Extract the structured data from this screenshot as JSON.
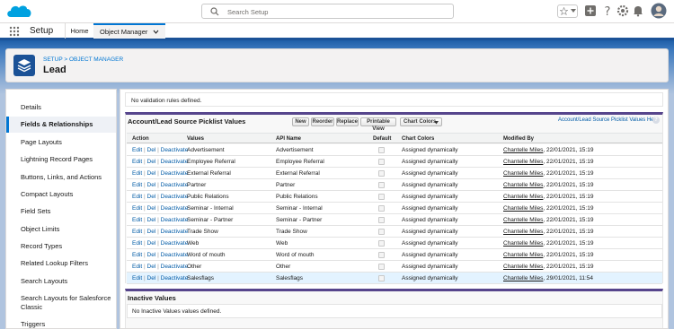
{
  "header": {
    "search_placeholder": "Search Setup"
  },
  "nav": {
    "app_name": "Setup",
    "tabs": [
      {
        "label": "Home"
      },
      {
        "label": "Object Manager"
      }
    ]
  },
  "page_header": {
    "breadcrumb": "SETUP > OBJECT MANAGER",
    "title": "Lead"
  },
  "sidebar": {
    "items": [
      {
        "label": "Details"
      },
      {
        "label": "Fields & Relationships",
        "active": true
      },
      {
        "label": "Page Layouts"
      },
      {
        "label": "Lightning Record Pages"
      },
      {
        "label": "Buttons, Links, and Actions"
      },
      {
        "label": "Compact Layouts"
      },
      {
        "label": "Field Sets"
      },
      {
        "label": "Object Limits"
      },
      {
        "label": "Record Types"
      },
      {
        "label": "Related Lookup Filters"
      },
      {
        "label": "Search Layouts"
      },
      {
        "label": "Search Layouts for Salesforce"
      },
      {
        "label": "Classic"
      },
      {
        "label": "Triggers"
      }
    ]
  },
  "validation": {
    "text": "No validation rules defined."
  },
  "picklist": {
    "title": "Account/Lead Source Picklist Values",
    "buttons": {
      "new": "New",
      "reorder": "Reorder",
      "replace": "Replace",
      "printable_view": "Printable View",
      "chart_colors": "Chart Colors"
    },
    "help_link": "Account/Lead Source Picklist Values Help",
    "help_icon": "?",
    "columns": {
      "action": "Action",
      "values": "Values",
      "api_name": "API Name",
      "default": "Default",
      "chart_colors": "Chart Colors",
      "modified_by": "Modified By"
    },
    "action_links": {
      "edit": "Edit",
      "del": "Del",
      "deactivate": "Deactivate",
      "sep": "|"
    },
    "rows": [
      {
        "value": "Advertisement",
        "api": "Advertisement",
        "color": "Assigned dynamically",
        "user": "Chantelle Miles",
        "date": ", 22/01/2021, 15:19"
      },
      {
        "value": "Employee Referral",
        "api": "Employee Referral",
        "color": "Assigned dynamically",
        "user": "Chantelle Miles",
        "date": ", 22/01/2021, 15:19"
      },
      {
        "value": "External Referral",
        "api": "External Referral",
        "color": "Assigned dynamically",
        "user": "Chantelle Miles",
        "date": ", 22/01/2021, 15:19"
      },
      {
        "value": "Partner",
        "api": "Partner",
        "color": "Assigned dynamically",
        "user": "Chantelle Miles",
        "date": ", 22/01/2021, 15:19"
      },
      {
        "value": "Public Relations",
        "api": "Public Relations",
        "color": "Assigned dynamically",
        "user": "Chantelle Miles",
        "date": ", 22/01/2021, 15:19"
      },
      {
        "value": "Seminar - Internal",
        "api": "Seminar - Internal",
        "color": "Assigned dynamically",
        "user": "Chantelle Miles",
        "date": ", 22/01/2021, 15:19"
      },
      {
        "value": "Seminar - Partner",
        "api": "Seminar - Partner",
        "color": "Assigned dynamically",
        "user": "Chantelle Miles",
        "date": ", 22/01/2021, 15:19"
      },
      {
        "value": "Trade Show",
        "api": "Trade Show",
        "color": "Assigned dynamically",
        "user": "Chantelle Miles",
        "date": ", 22/01/2021, 15:19"
      },
      {
        "value": "Web",
        "api": "Web",
        "color": "Assigned dynamically",
        "user": "Chantelle Miles",
        "date": ", 22/01/2021, 15:19"
      },
      {
        "value": "Word of mouth",
        "api": "Word of mouth",
        "color": "Assigned dynamically",
        "user": "Chantelle Miles",
        "date": ", 22/01/2021, 15:19"
      },
      {
        "value": "Other",
        "api": "Other",
        "color": "Assigned dynamically",
        "user": "Chantelle Miles",
        "date": ", 22/01/2021, 15:19"
      },
      {
        "value": "Salesflags",
        "api": "Salesflags",
        "color": "Assigned dynamically",
        "user": "Chantelle Miles",
        "date": ", 29/01/2021, 11:54",
        "highlighted": true
      }
    ]
  },
  "inactive": {
    "title": "Inactive Values",
    "text": "No Inactive Values values defined."
  },
  "colors": {
    "brand": "#0176d3",
    "header_band": "#1b5297",
    "section_accent": "#56458c",
    "link": "#015ba7"
  }
}
